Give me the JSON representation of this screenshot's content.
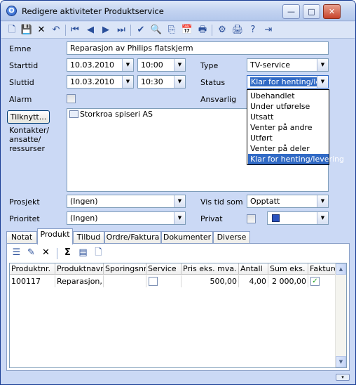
{
  "window": {
    "title": "Redigere aktiviteter Produktservice",
    "minimize": "—",
    "maximize": "□",
    "close": "✕"
  },
  "toolbar": {
    "icons": [
      "new-icon",
      "save-icon",
      "delete-icon",
      "undo-icon",
      "first-icon",
      "prev-icon",
      "next-icon",
      "last-icon",
      "check-icon",
      "preview-icon",
      "copy-icon",
      "calendar-icon",
      "print-icon",
      "settings-icon",
      "print2-icon",
      "help-icon",
      "exit-icon"
    ]
  },
  "form": {
    "emne_label": "Emne",
    "emne_value": "Reparasjon av Philips flatskjerm",
    "starttid_label": "Starttid",
    "start_date": "10.03.2010",
    "start_time": "10:00",
    "sluttid_label": "Sluttid",
    "end_date": "10.03.2010",
    "end_time": "10:30",
    "type_label": "Type",
    "type_value": "TV-service",
    "status_label": "Status",
    "status_value": "Klar for henting/levering",
    "alarm_label": "Alarm",
    "ansvarlig_label": "Ansvarlig",
    "tilknytt_button": "Tilknytt...",
    "kontakter_label": "Kontakter/\nansatte/\nressurser",
    "contact_item": "Storkroa spiseri AS",
    "prosjekt_label": "Prosjekt",
    "prosjekt_value": "(Ingen)",
    "prioritet_label": "Prioritet",
    "prioritet_value": "(Ingen)",
    "vis_tid_label": "Vis tid som",
    "vis_tid_value": "Opptatt",
    "privat_label": "Privat",
    "color_value": "#2a52be"
  },
  "status_options": [
    "Ubehandlet",
    "Under utførelse",
    "Utsatt",
    "Venter på andre",
    "Utført",
    "Venter på deler",
    "Klar for henting/levering"
  ],
  "status_selected_index": 6,
  "tabs": [
    "Notat",
    "Produkt",
    "Tilbud",
    "Ordre/Faktura",
    "Dokumenter",
    "Diverse"
  ],
  "active_tab": "Produkt",
  "product_toolbar": {
    "icons": [
      "edit-list-icon",
      "edit-icon",
      "delete-icon",
      "sum-icon",
      "stack-icon",
      "document-icon"
    ],
    "sum": "Σ"
  },
  "grid": {
    "columns": [
      "Produktnr.",
      "Produktnavn",
      "Sporingsnr.",
      "Service",
      "Pris eks. mva.",
      "Antall",
      "Sum eks. mva.",
      "Fakturer"
    ],
    "rows": [
      {
        "nr": "100117",
        "navn": "Reparasjon, ti",
        "spor": "",
        "service": false,
        "pris": "500,00",
        "antall": "4,00",
        "sum": "2 000,00",
        "fakturer": true
      }
    ]
  }
}
